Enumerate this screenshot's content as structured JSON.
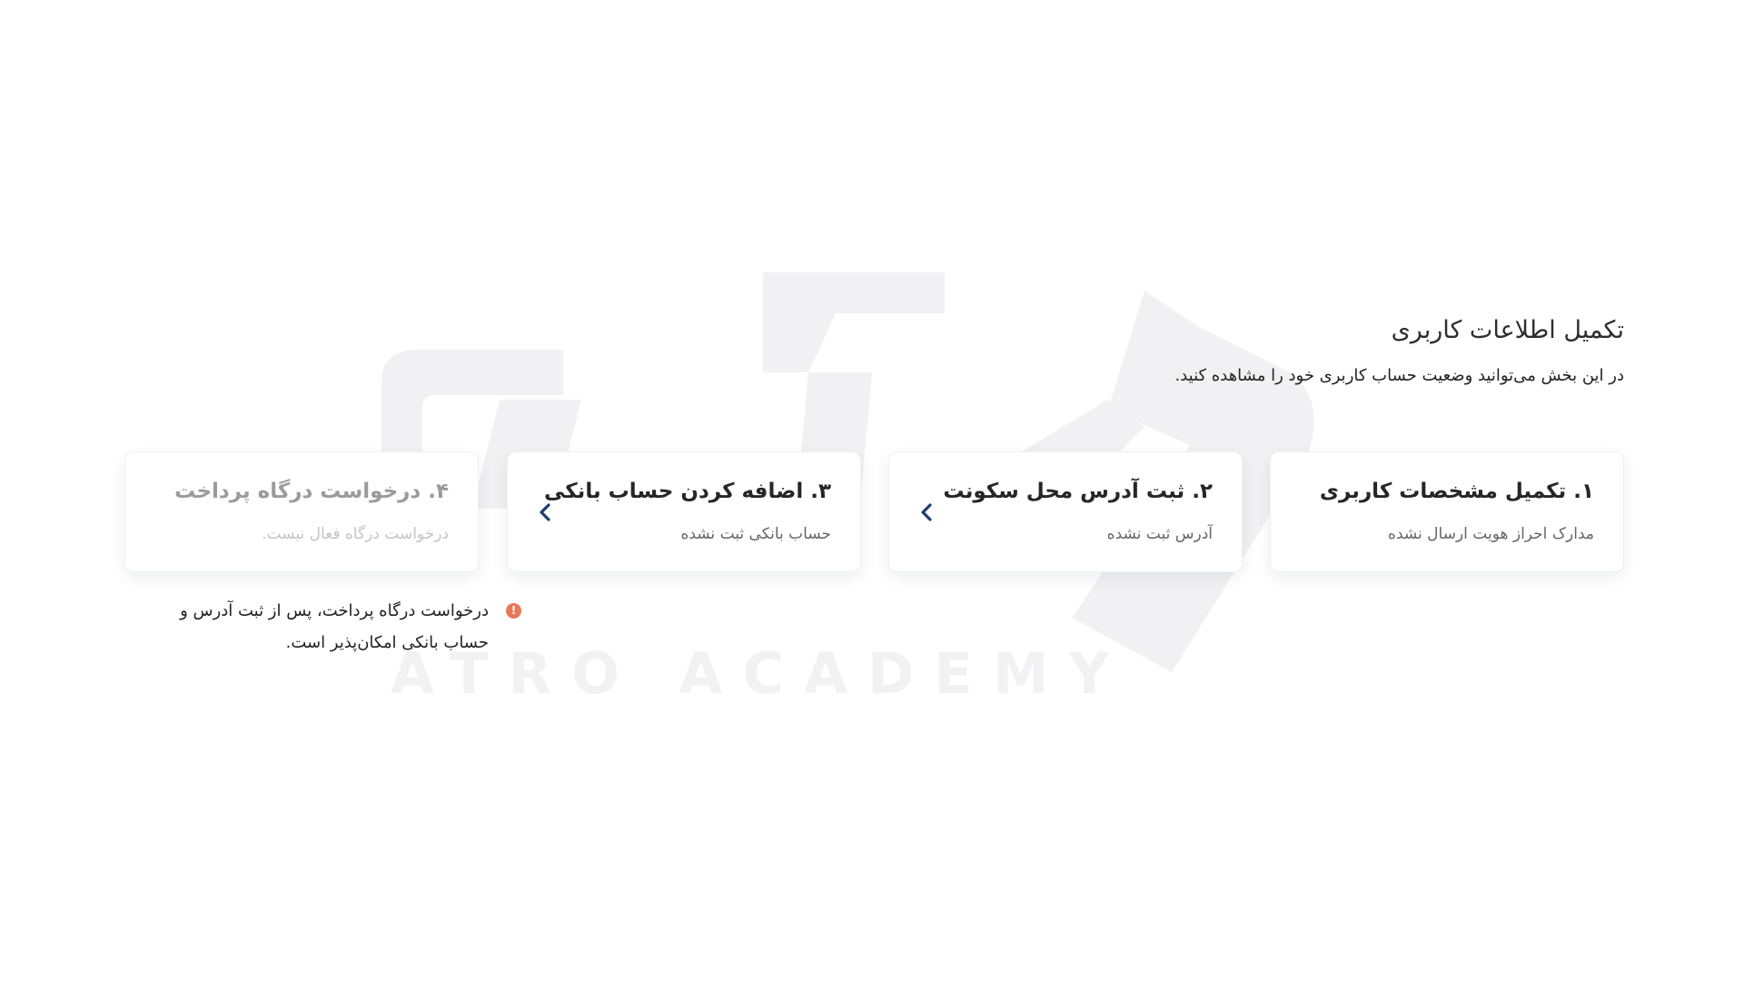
{
  "header": {
    "title": "تکمیل اطلاعات کاربری",
    "description": "در این بخش می‌توانید وضعیت حساب کاربری خود را مشاهده کنید."
  },
  "steps": [
    {
      "title": "۱. تکمیل مشخصات کاربری",
      "subtitle": "مدارک احراز هویت ارسال نشده",
      "disabled": false,
      "has_arrow": false
    },
    {
      "title": "۲. ثبت آدرس محل سکونت",
      "subtitle": "آدرس ثبت نشده",
      "disabled": false,
      "has_arrow": true
    },
    {
      "title": "۳. اضافه کردن حساب بانکی",
      "subtitle": "حساب بانکی ثبت نشده",
      "disabled": false,
      "has_arrow": true
    },
    {
      "title": "۴. درخواست درگاه پرداخت",
      "subtitle": "درخواست درگاه فعال نیست.",
      "disabled": true,
      "has_arrow": false
    }
  ],
  "note": {
    "icon": "info-icon",
    "text": "درخواست درگاه پرداخت، پس از ثبت آدرس و حساب بانکی امکان‌پذیر است."
  },
  "watermark": {
    "text": "ATRO ACADEMY"
  },
  "colors": {
    "accent": "#1f3d6e",
    "warning": "#e9785a",
    "watermark": "#f1f1f3"
  }
}
